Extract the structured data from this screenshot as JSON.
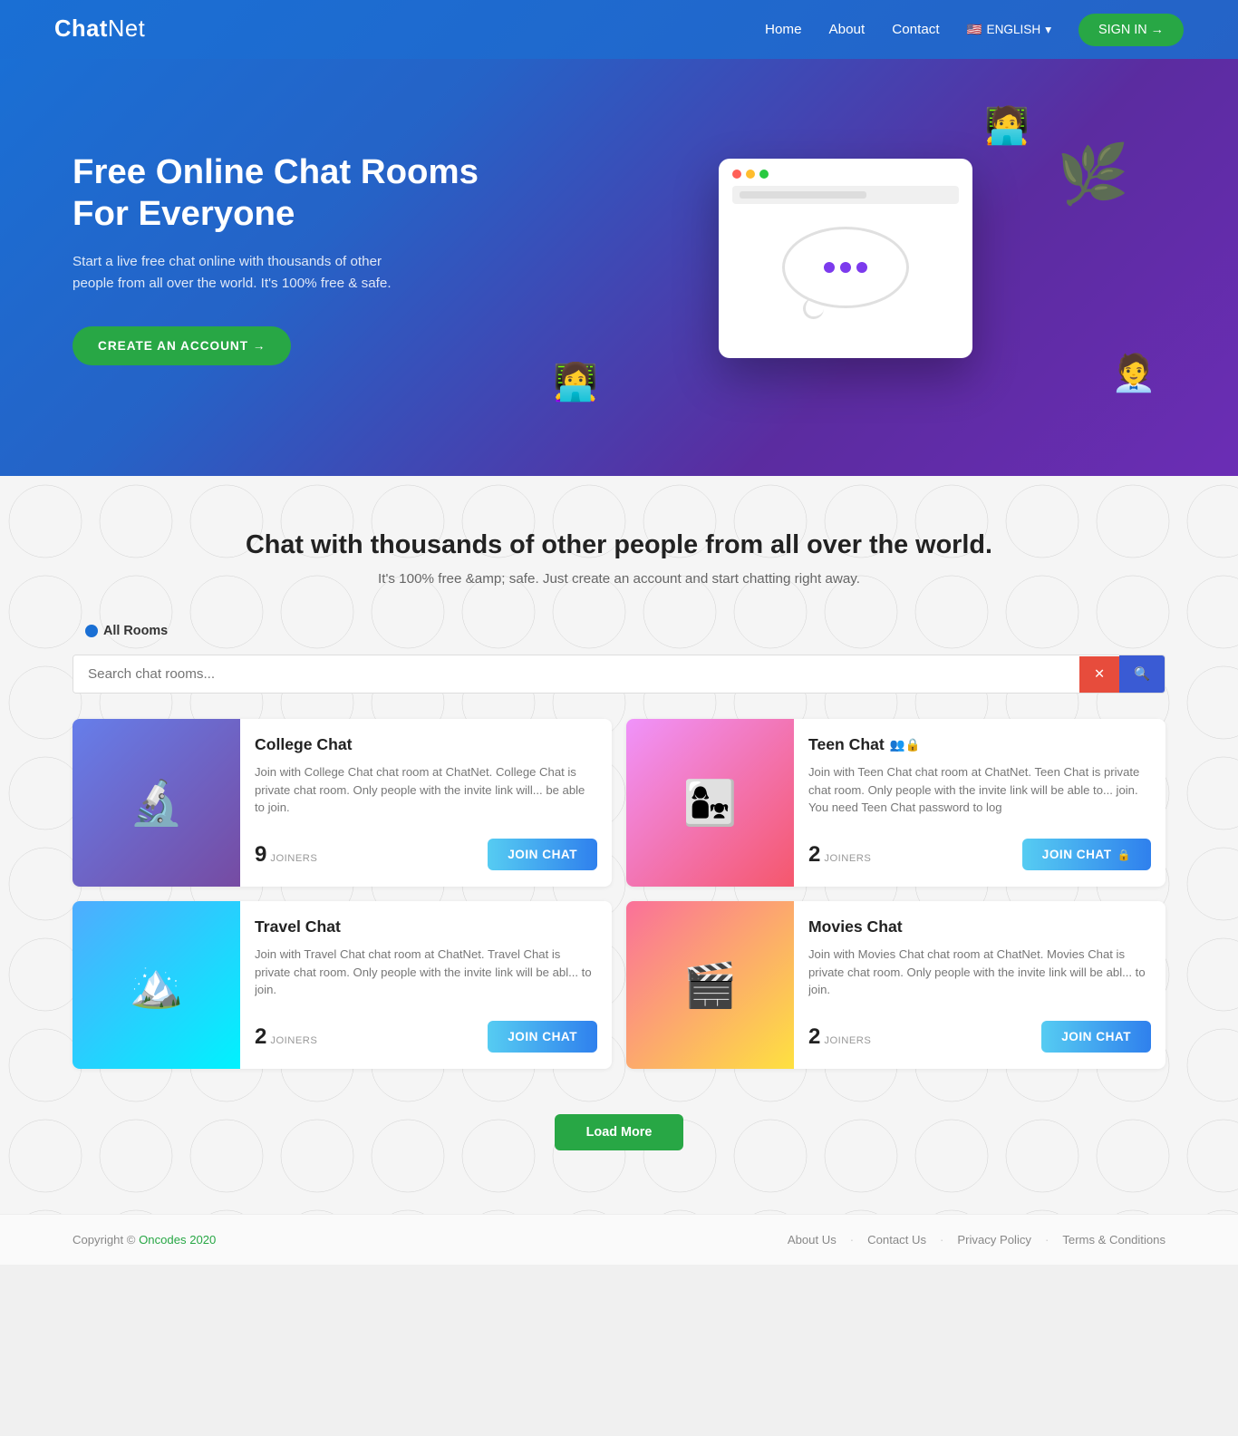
{
  "brand": {
    "name_bold": "Chat",
    "name_regular": "Net"
  },
  "navbar": {
    "links": [
      {
        "id": "home",
        "label": "Home"
      },
      {
        "id": "about",
        "label": "About"
      },
      {
        "id": "contact",
        "label": "Contact"
      }
    ],
    "language": "ENGLISH",
    "sign_in": "SIGN IN →"
  },
  "hero": {
    "title": "Free Online Chat Rooms For Everyone",
    "subtitle": "Start a live free chat online with thousands of other people from all over the world. It's 100% free & safe.",
    "cta": "CREATE AN ACCOUNT →"
  },
  "section": {
    "heading": "Chat with thousands of other people from all over the world.",
    "subheading": "It's 100% free &amp; safe. Just create an account and start chatting right away.",
    "tab_label": "All Rooms",
    "search_placeholder": "Search chat rooms..."
  },
  "rooms": [
    {
      "id": "college",
      "name": "College Chat",
      "description": "Join with College Chat chat room at ChatNet. College Chat is private chat room. Only people with the invite link will... be able to join.",
      "joiners": "9",
      "join_btn": "JOIN CHAT",
      "private": false
    },
    {
      "id": "teen",
      "name": "Teen Chat",
      "description": "Join with Teen Chat chat room at ChatNet. Teen Chat is private chat room. Only people with the invite link will be able to... join. You need Teen Chat password to log",
      "joiners": "2",
      "join_btn": "JOIN CHAT 🔒",
      "private": true
    },
    {
      "id": "travel",
      "name": "Travel Chat",
      "description": "Join with Travel Chat chat room at ChatNet. Travel Chat is private chat room. Only people with the invite link will be abl... to join.",
      "joiners": "2",
      "join_btn": "JOIN CHAT",
      "private": false
    },
    {
      "id": "movies",
      "name": "Movies Chat",
      "description": "Join with Movies Chat chat room at ChatNet. Movies Chat is private chat room. Only people with the invite link will be abl... to join.",
      "joiners": "2",
      "join_btn": "JOIN CHAT",
      "private": false
    }
  ],
  "load_more": "Load More",
  "footer": {
    "copyright": "Copyright ©",
    "brand": "Oncodes 2020",
    "links": [
      {
        "id": "about-us",
        "label": "About Us"
      },
      {
        "id": "contact-us",
        "label": "Contact Us"
      },
      {
        "id": "privacy",
        "label": "Privacy Policy"
      },
      {
        "id": "terms",
        "label": "Terms & Conditions"
      }
    ]
  },
  "colors": {
    "brand_blue": "#1a6fd4",
    "brand_green": "#28a745",
    "hero_gradient_start": "#1a6fd4",
    "hero_gradient_end": "#6b2db5",
    "join_btn_gradient": "linear-gradient(90deg, #56ccf2, #2f80ed)"
  }
}
